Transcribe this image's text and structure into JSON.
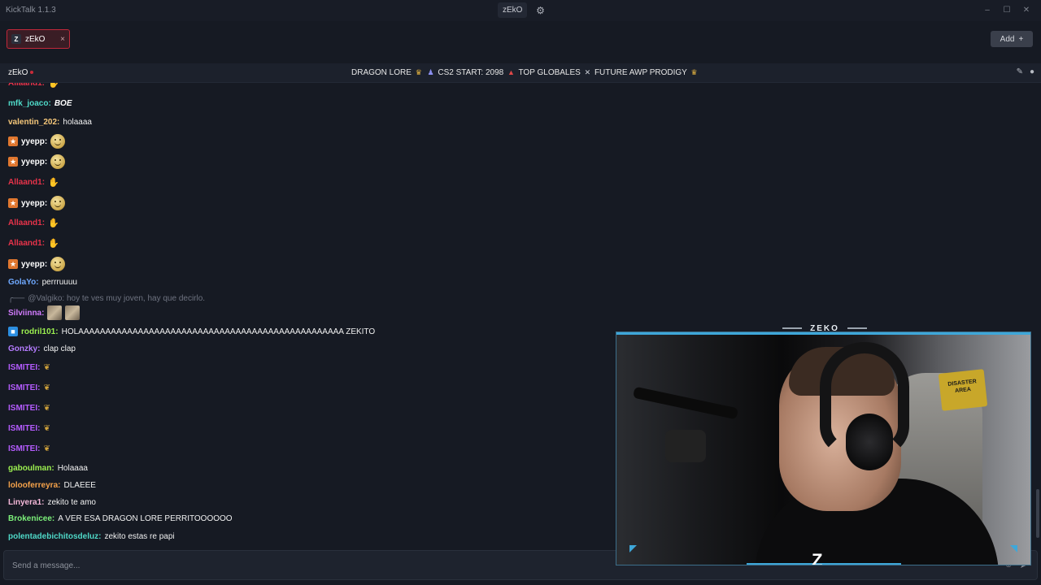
{
  "app": {
    "title": "KickTalk 1.1.3"
  },
  "titlebar": {
    "channel_button": "zEkO",
    "win_min": "–",
    "win_max": "☐",
    "win_close": "✕"
  },
  "tabs": [
    {
      "label": "zEkO",
      "avatar": "Z",
      "close": "×"
    }
  ],
  "add_button": {
    "label": "Add",
    "icon": "+"
  },
  "channel": {
    "name": "zEkO",
    "stream_title": {
      "part1": "DRAGON LORE",
      "part2": "CS2 START: 2098",
      "part3": "TOP GLOBALES",
      "part4": "FUTURE AWP PRODIGY"
    }
  },
  "colors": {
    "background": "#161a23",
    "accent_red": "#c2283a",
    "accent_blue": "#3ea7d9"
  },
  "messages": [
    {
      "user": "mfk_joaco",
      "color": "#4fd9c8",
      "text": "",
      "emote": "boe",
      "emote_text": "BOE"
    },
    {
      "user": "valentin_202",
      "color": "#f5c77a",
      "text": "holaaaa"
    },
    {
      "user": "yyepp",
      "color": "#ffffff",
      "badge": "fire",
      "emote": "smile"
    },
    {
      "user": "yyepp",
      "color": "#ffffff",
      "badge": "fire",
      "emote": "smile"
    },
    {
      "user": "Allaand1",
      "color": "#e6334a",
      "emote": "hands"
    },
    {
      "user": "yyepp",
      "color": "#ffffff",
      "badge": "fire",
      "emote": "smile"
    },
    {
      "user": "Allaand1",
      "color": "#e6334a",
      "emote": "hands"
    },
    {
      "user": "Allaand1",
      "color": "#e6334a",
      "emote": "hands"
    },
    {
      "user": "yyepp",
      "color": "#ffffff",
      "badge": "fire",
      "emote": "smile"
    },
    {
      "user": "GolaYo",
      "color": "#6fa9ff",
      "text": "perrruuuu"
    },
    {
      "reply": "@Valgiko: hoy te ves muy joven, hay que decirlo."
    },
    {
      "user": "Silviinna",
      "color": "#d27cff",
      "emote": "pics"
    },
    {
      "user": "rodril101",
      "color": "#9cf050",
      "badge": "cube",
      "text": "HOLAAAAAAAAAAAAAAAAAAAAAAAAAAAAAAAAAAAAAAAAAAAAAAAAA ZEKITO"
    },
    {
      "user": "Gonzky",
      "color": "#b57cff",
      "text": "clap clap"
    },
    {
      "user": "ISMITEI",
      "color": "#b55cff",
      "emote": "leaf"
    },
    {
      "user": "ISMITEI",
      "color": "#b55cff",
      "emote": "leaf"
    },
    {
      "user": "ISMITEI",
      "color": "#b55cff",
      "emote": "leaf"
    },
    {
      "user": "ISMITEI",
      "color": "#b55cff",
      "emote": "leaf"
    },
    {
      "user": "ISMITEI",
      "color": "#b55cff",
      "emote": "leaf"
    },
    {
      "user": "gaboulman",
      "color": "#9cf050",
      "text": "Holaaaa"
    },
    {
      "user": "lolooferreyra",
      "color": "#f5a24a",
      "text": "DLAEEE"
    },
    {
      "user": "Linyera1",
      "color": "#f5b8d9",
      "text": "zekito te amo"
    },
    {
      "user": "Brokenicee",
      "color": "#7cf07a",
      "text": "A VER ESA DRAGON LORE PERRITOOOOOO"
    },
    {
      "user": "polentadebichitosdeluz",
      "color": "#4fd9c8",
      "text": "zekito estas re papi"
    }
  ],
  "input": {
    "placeholder": "Send a message..."
  },
  "video": {
    "overlay_brand": "ZEKO",
    "sign_text": "DISASTER AREA",
    "logo": "Z"
  }
}
